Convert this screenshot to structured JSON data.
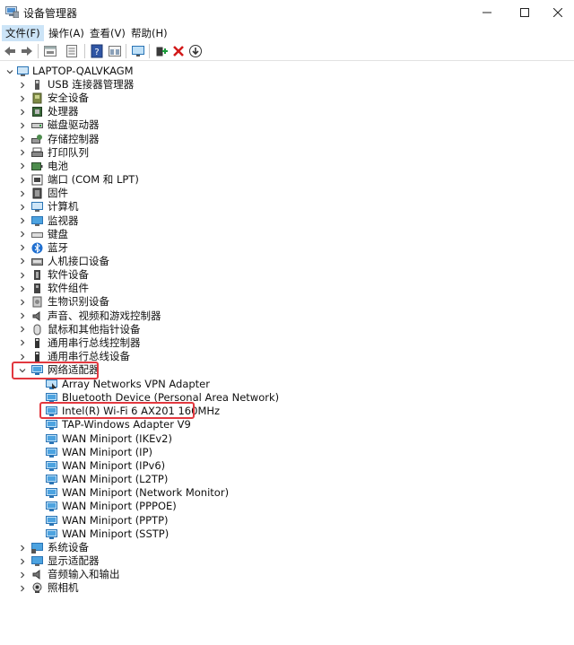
{
  "window": {
    "title": "设备管理器"
  },
  "menu": {
    "file": "文件(F)",
    "action": "操作(A)",
    "view": "查看(V)",
    "help": "帮助(H)"
  },
  "toolbar_icons": [
    "back-arrow-icon",
    "forward-arrow-icon",
    "properties-icon",
    "list-icon",
    "help-icon",
    "view-icon",
    "monitor-scan-icon",
    "add-driver-icon",
    "uninstall-x-icon",
    "update-driver-icon"
  ],
  "tree": {
    "root": "LAPTOP-QALVKAGM",
    "categories_top": [
      "USB 连接器管理器",
      "安全设备",
      "处理器",
      "磁盘驱动器",
      "存储控制器",
      "打印队列",
      "电池",
      "端口 (COM 和 LPT)",
      "固件",
      "计算机",
      "监视器",
      "键盘",
      "蓝牙",
      "人机接口设备",
      "软件设备",
      "软件组件",
      "生物识别设备",
      "声音、视频和游戏控制器",
      "鼠标和其他指针设备",
      "通用串行总线控制器",
      "通用串行总线设备"
    ],
    "network_category": "网络适配器",
    "network_devices": [
      "Array Networks VPN Adapter",
      "Bluetooth Device (Personal Area Network)",
      "Intel(R) Wi-Fi 6 AX201 160MHz",
      "TAP-Windows Adapter V9",
      "WAN Miniport (IKEv2)",
      "WAN Miniport (IP)",
      "WAN Miniport (IPv6)",
      "WAN Miniport (L2TP)",
      "WAN Miniport (Network Monitor)",
      "WAN Miniport (PPPOE)",
      "WAN Miniport (PPTP)",
      "WAN Miniport (SSTP)"
    ],
    "categories_bottom": [
      "系统设备",
      "显示适配器",
      "音频输入和输出",
      "照相机"
    ],
    "highlight_color": "#e2383f"
  }
}
